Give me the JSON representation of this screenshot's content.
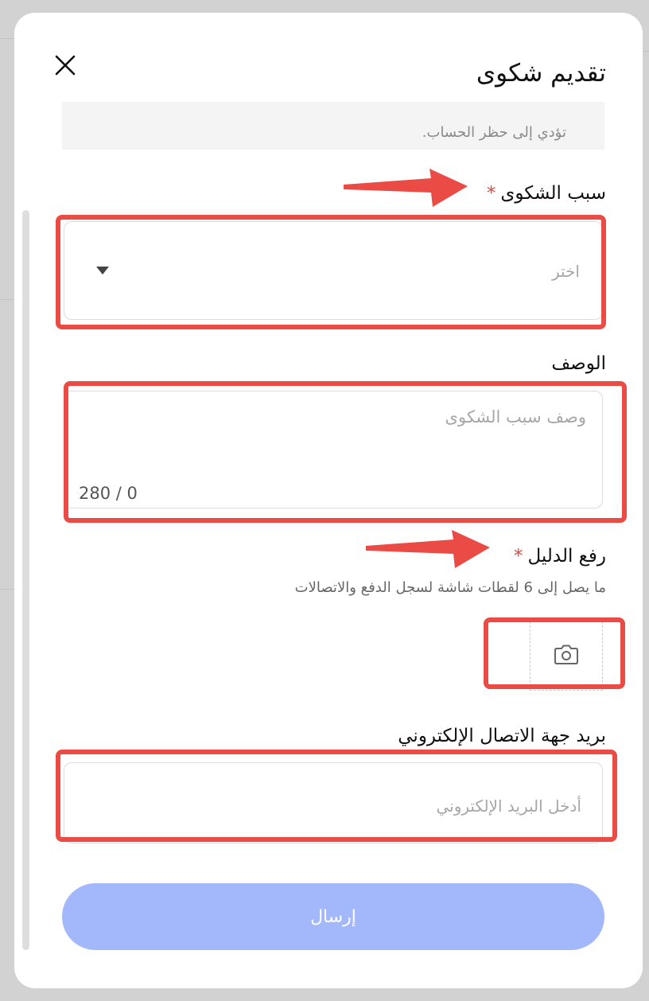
{
  "modal": {
    "title": "تقديم شكوى",
    "notice_text": "تؤدي إلى حظر الحساب."
  },
  "reason": {
    "label": "سبب الشكوى",
    "required_mark": "*",
    "placeholder": "اختر"
  },
  "description": {
    "label": "الوصف",
    "placeholder": "وصف سبب الشكوى",
    "counter": "280 / 0"
  },
  "evidence": {
    "label": "رفع الدليل",
    "required_mark": "*",
    "hint": "ما يصل إلى 6 لقطات شاشة لسجل الدفع والاتصالات"
  },
  "email": {
    "label": "بريد جهة الاتصال الإلكتروني",
    "placeholder": "أدخل البريد الإلكتروني"
  },
  "submit": {
    "label": "إرسال"
  },
  "colors": {
    "accent": "#a2b8fb",
    "required": "#e3463f",
    "annotation": "#ea4b45"
  },
  "icons": [
    "close-icon",
    "chevron-down-icon",
    "camera-icon",
    "arrow-annotation-icon"
  ]
}
